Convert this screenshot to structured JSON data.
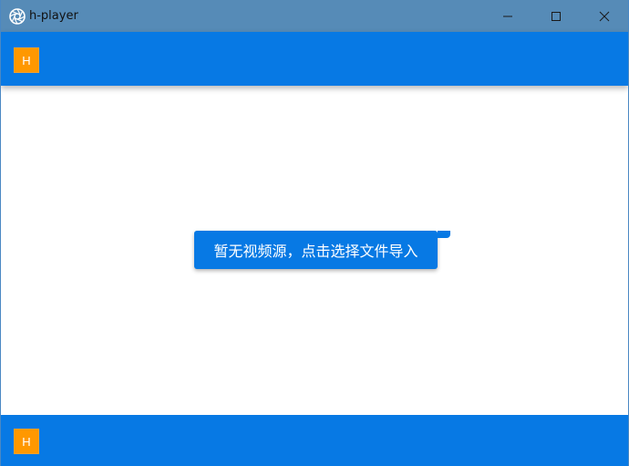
{
  "window": {
    "title": "h-player",
    "icon": "aperture-icon",
    "controls": [
      "minimize-icon",
      "maximize-icon",
      "close-icon"
    ]
  },
  "header": {
    "badge_label": "H"
  },
  "main": {
    "import_button_label": "暂无视频源，点击选择文件导入"
  },
  "footer": {
    "badge_label": "H"
  },
  "colors": {
    "titlebar": "#568bb7",
    "primary": "#0779e4",
    "badge": "#ff9800",
    "background": "#ffffff"
  }
}
